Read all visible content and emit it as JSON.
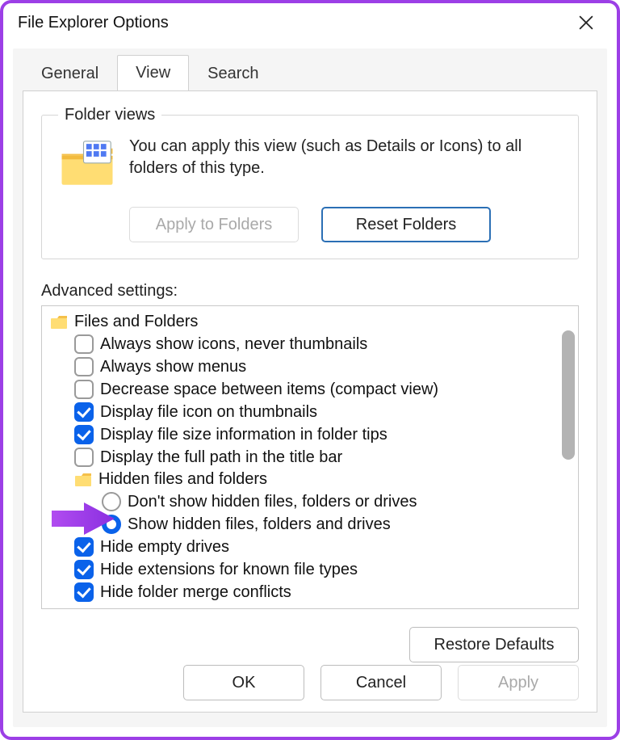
{
  "window": {
    "title": "File Explorer Options"
  },
  "tabs": {
    "general": "General",
    "view": "View",
    "search": "Search",
    "active": "view"
  },
  "folder_views": {
    "legend": "Folder views",
    "description": "You can apply this view (such as Details or Icons) to all folders of this type.",
    "apply_label": "Apply to Folders",
    "reset_label": "Reset Folders"
  },
  "advanced": {
    "label": "Advanced settings:",
    "root_label": "Files and Folders",
    "items": [
      {
        "type": "checkbox",
        "checked": false,
        "label": "Always show icons, never thumbnails"
      },
      {
        "type": "checkbox",
        "checked": false,
        "label": "Always show menus"
      },
      {
        "type": "checkbox",
        "checked": false,
        "label": "Decrease space between items (compact view)"
      },
      {
        "type": "checkbox",
        "checked": true,
        "label": "Display file icon on thumbnails"
      },
      {
        "type": "checkbox",
        "checked": true,
        "label": "Display file size information in folder tips"
      },
      {
        "type": "checkbox",
        "checked": false,
        "label": "Display the full path in the title bar"
      }
    ],
    "hidden_group_label": "Hidden files and folders",
    "hidden_options": [
      {
        "selected": false,
        "label": "Don't show hidden files, folders or drives"
      },
      {
        "selected": true,
        "label": "Show hidden files, folders and drives"
      }
    ],
    "items_after": [
      {
        "type": "checkbox",
        "checked": true,
        "label": "Hide empty drives"
      },
      {
        "type": "checkbox",
        "checked": true,
        "label": "Hide extensions for known file types"
      },
      {
        "type": "checkbox",
        "checked": true,
        "label": "Hide folder merge conflicts"
      }
    ]
  },
  "buttons": {
    "restore_defaults": "Restore Defaults",
    "ok": "OK",
    "cancel": "Cancel",
    "apply": "Apply"
  }
}
